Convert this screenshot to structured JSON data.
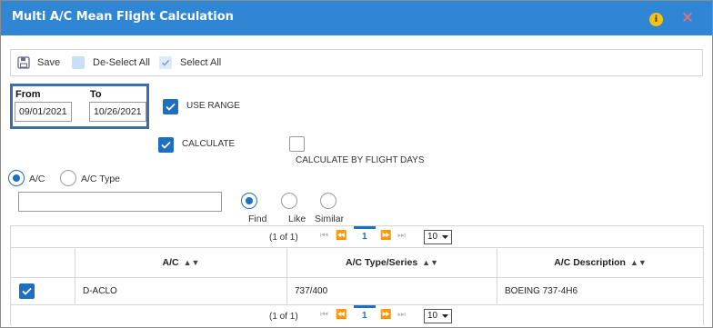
{
  "window": {
    "title": "Multi A/C Mean Flight Calculation",
    "info_icon": "info-icon",
    "close_icon": "close-icon",
    "accent": "#2e86d4"
  },
  "toolbar": {
    "save_label": "Save",
    "deselect_all_label": "De-Select All",
    "select_all_label": "Select All"
  },
  "date_range": {
    "from_label": "From",
    "from_value": "09/01/2021",
    "to_label": "To",
    "to_value": "10/26/2021"
  },
  "options": {
    "use_range_label": "USE RANGE",
    "use_range_checked": true,
    "calculate_label": "CALCULATE",
    "calculate_checked": true,
    "calc_by_flight_days_label": "CALCULATE BY FLIGHT DAYS",
    "calc_by_flight_days_checked": false
  },
  "search_mode": {
    "ac_label": "A/C",
    "ac_type_label": "A/C Type",
    "selected": "A/C",
    "input_value": "",
    "find_label": "Find",
    "like_label": "Like",
    "similar_label": "Similar",
    "match_selected": "Find"
  },
  "pager": {
    "count_text": "(1 of 1)",
    "current_page": "1",
    "page_size": "10"
  },
  "table": {
    "columns": [
      "A/C",
      "A/C Type/Series",
      "A/C Description"
    ],
    "rows": [
      {
        "checked": true,
        "ac": "D-ACLO",
        "type_series": "737/400",
        "description": "BOEING 737-4H6"
      }
    ]
  }
}
